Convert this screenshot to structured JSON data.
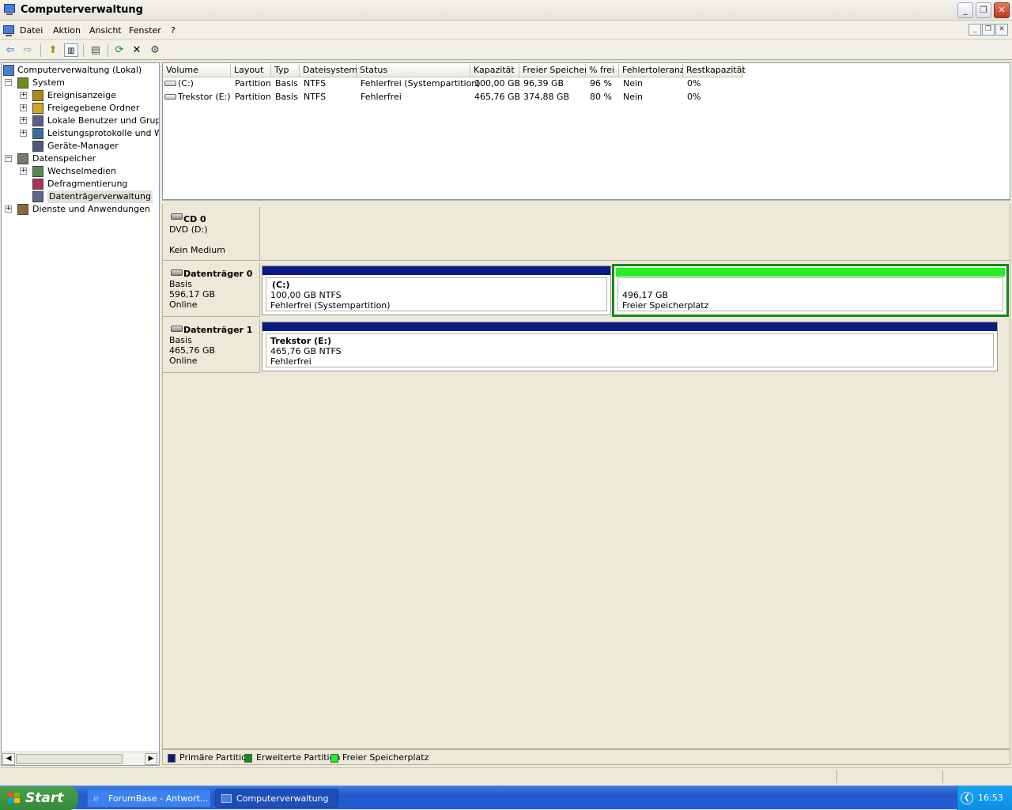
{
  "window": {
    "title": "Computerverwaltung"
  },
  "menu": {
    "items": [
      "Datei",
      "Aktion",
      "Ansicht",
      "Fenster",
      "?"
    ]
  },
  "tree": {
    "nodes": [
      {
        "label": "Computerverwaltung (Lokal)",
        "expander": "",
        "icon": "computer-management-icon"
      },
      {
        "label": "System",
        "expander": "−",
        "icon": "system-tools-icon"
      },
      {
        "label": "Ereignisanzeige",
        "expander": "+",
        "icon": "event-viewer-icon"
      },
      {
        "label": "Freigegebene Ordner",
        "expander": "+",
        "icon": "shared-folder-icon"
      },
      {
        "label": "Lokale Benutzer und Gruppen",
        "expander": "+",
        "icon": "users-icon"
      },
      {
        "label": "Leistungsprotokolle und Warnungen",
        "expander": "+",
        "icon": "performance-icon"
      },
      {
        "label": "Geräte-Manager",
        "expander": "",
        "icon": "device-manager-icon"
      },
      {
        "label": "Datenspeicher",
        "expander": "−",
        "icon": "storage-icon"
      },
      {
        "label": "Wechselmedien",
        "expander": "+",
        "icon": "removable-media-icon"
      },
      {
        "label": "Defragmentierung",
        "expander": "",
        "icon": "defrag-icon"
      },
      {
        "label": "Datenträgerverwaltung",
        "expander": "",
        "icon": "disk-management-icon"
      },
      {
        "label": "Dienste und Anwendungen",
        "expander": "+",
        "icon": "services-icon"
      }
    ]
  },
  "volumes": {
    "columns": [
      "Volume",
      "Layout",
      "Typ",
      "Dateisystem",
      "Status",
      "Kapazität",
      "Freier Speicher",
      "% frei",
      "Fehlertoleranz",
      "Restkapazität"
    ],
    "rows": [
      [
        "(C:)",
        "Partition",
        "Basis",
        "NTFS",
        "Fehlerfrei (Systempartition)",
        "100,00 GB",
        "96,39 GB",
        "96 %",
        "Nein",
        "0%"
      ],
      [
        "Trekstor (E:)",
        "Partition",
        "Basis",
        "NTFS",
        "Fehlerfrei",
        "465,76 GB",
        "374,88 GB",
        "80 %",
        "Nein",
        "0%"
      ]
    ]
  },
  "disks": {
    "cd0": {
      "name": "CD 0",
      "line1": "DVD (D:)",
      "line2": "Kein Medium"
    },
    "disk0": {
      "name": "Datenträger 0",
      "type": "Basis",
      "size": "596,17 GB",
      "state": "Online",
      "partitions": [
        {
          "title": "(C:)",
          "size": "100,00 GB NTFS",
          "status": "Fehlerfrei (Systempartition)"
        },
        {
          "title": "",
          "size": "496,17 GB",
          "status": "Freier Speicherplatz"
        }
      ]
    },
    "disk1": {
      "name": "Datenträger 1",
      "type": "Basis",
      "size": "465,76 GB",
      "state": "Online",
      "partitions": [
        {
          "title": "Trekstor  (E:)",
          "size": "465,76 GB NTFS",
          "status": "Fehlerfrei"
        }
      ]
    }
  },
  "legend": {
    "primary": "Primäre Partition",
    "extended": "Erweiterte Partition",
    "free": "Freier Speicherplatz"
  },
  "colors": {
    "primary": "#0a1a82",
    "extended": "#138c13",
    "free": "#22f022"
  },
  "taskbar": {
    "start": "Start",
    "tasks": [
      "ForumBase - Antwort...",
      "Computerverwaltung"
    ],
    "clock": "16:53"
  }
}
